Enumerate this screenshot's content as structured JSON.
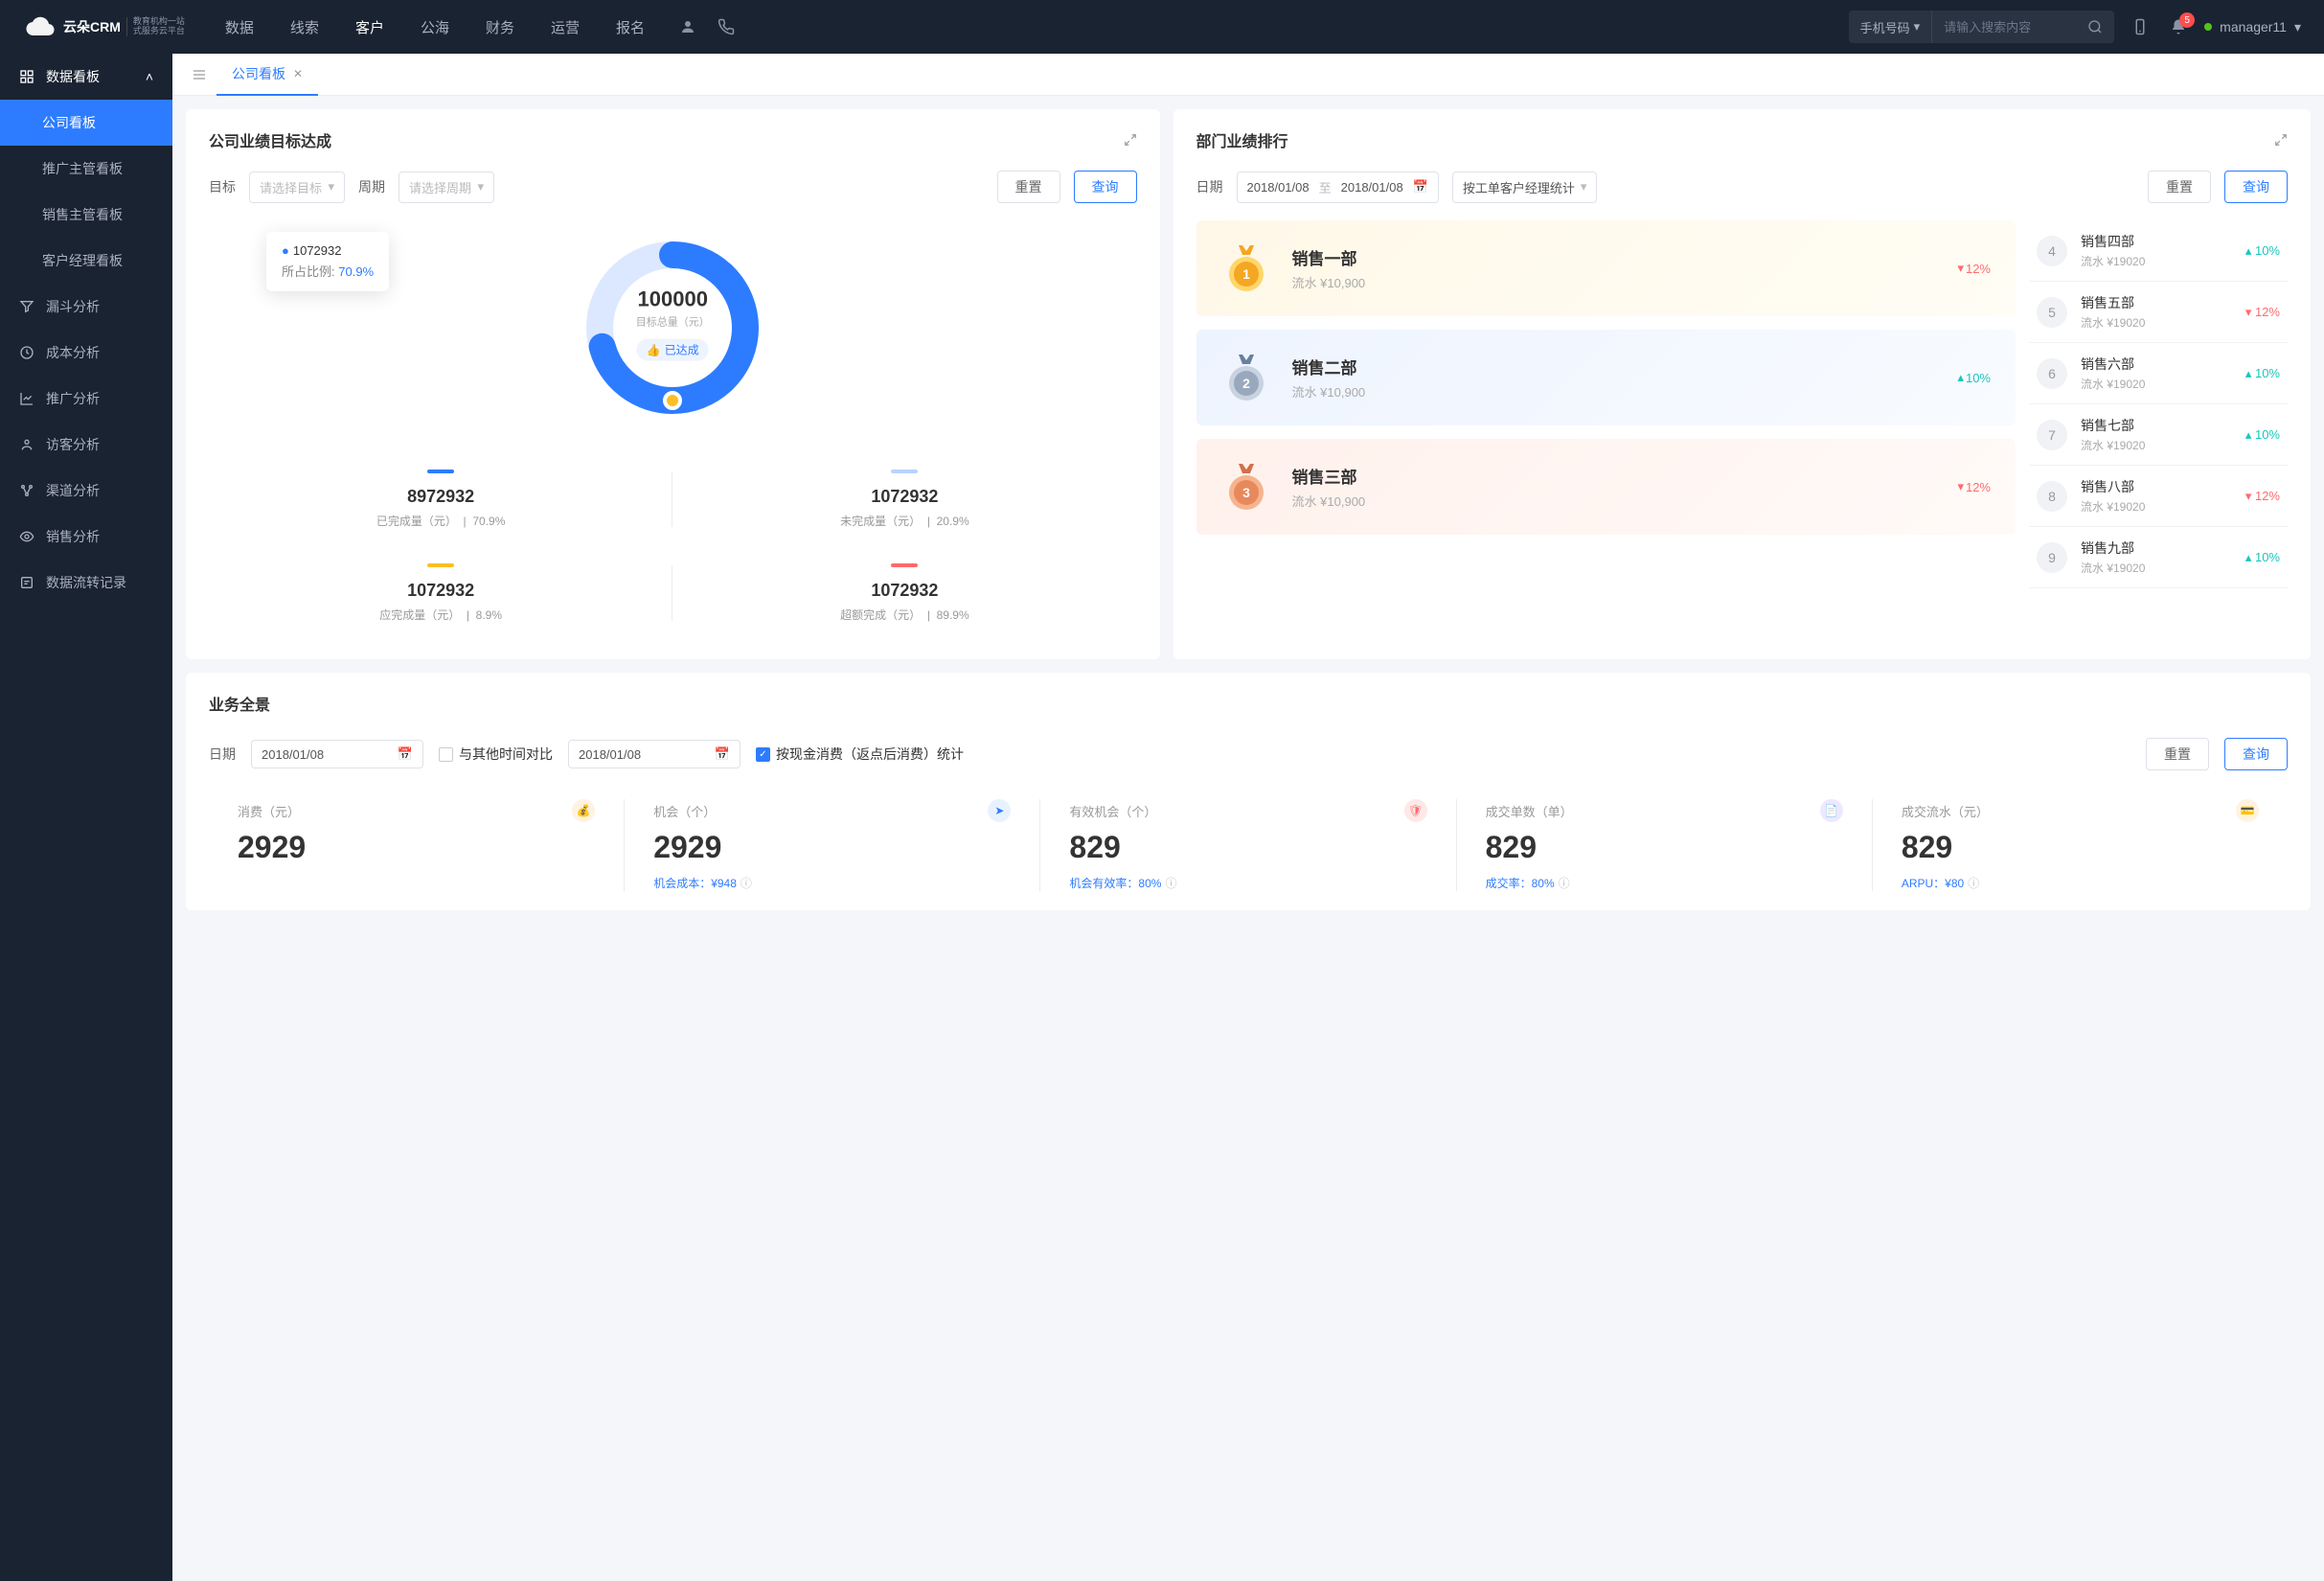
{
  "brand": {
    "name": "云朵CRM",
    "tagline_l1": "教育机构一站",
    "tagline_l2": "式服务云平台"
  },
  "topnav": {
    "items": [
      "数据",
      "线索",
      "客户",
      "公海",
      "财务",
      "运营",
      "报名"
    ],
    "active_index": 2,
    "search_type": "手机号码",
    "search_placeholder": "请输入搜索内容",
    "notification_count": "5",
    "username": "manager11"
  },
  "sidebar": {
    "group_header": "数据看板",
    "group_items": [
      "公司看板",
      "推广主管看板",
      "销售主管看板",
      "客户经理看板"
    ],
    "active_index": 0,
    "singles": [
      {
        "icon": "funnel",
        "label": "漏斗分析"
      },
      {
        "icon": "clock",
        "label": "成本分析"
      },
      {
        "icon": "chart",
        "label": "推广分析"
      },
      {
        "icon": "visitor",
        "label": "访客分析"
      },
      {
        "icon": "channel",
        "label": "渠道分析"
      },
      {
        "icon": "eye",
        "label": "销售分析"
      },
      {
        "icon": "flow",
        "label": "数据流转记录"
      }
    ]
  },
  "tabs": {
    "current": "公司看板"
  },
  "target_card": {
    "title": "公司业绩目标达成",
    "filters": {
      "goal_label": "目标",
      "goal_placeholder": "请选择目标",
      "period_label": "周期",
      "period_placeholder": "请选择周期",
      "reset": "重置",
      "query": "查询"
    },
    "tooltip": {
      "value": "1072932",
      "ratio_label": "所占比例:",
      "ratio_value": "70.9%"
    },
    "center": {
      "value": "100000",
      "label": "目标总量（元）",
      "badge": "已达成"
    },
    "stats": [
      {
        "color": "#2d7cff",
        "value": "8972932",
        "label": "已完成量（元）",
        "pct": "70.9%"
      },
      {
        "color": "#b8d4ff",
        "value": "1072932",
        "label": "未完成量（元）",
        "pct": "20.9%"
      },
      {
        "color": "#fbbf24",
        "value": "1072932",
        "label": "应完成量（元）",
        "pct": "8.9%"
      },
      {
        "color": "#ff6b6b",
        "value": "1072932",
        "label": "超额完成（元）",
        "pct": "89.9%"
      }
    ]
  },
  "rank_card": {
    "title": "部门业绩排行",
    "filters": {
      "date_label": "日期",
      "date_from": "2018/01/08",
      "date_sep": "至",
      "date_to": "2018/01/08",
      "stat_by": "按工单客户经理统计",
      "reset": "重置",
      "query": "查询"
    },
    "podium": [
      {
        "rank": 1,
        "name": "销售一部",
        "sub": "流水 ¥10,900",
        "pct": "12%",
        "dir": "down"
      },
      {
        "rank": 2,
        "name": "销售二部",
        "sub": "流水 ¥10,900",
        "pct": "10%",
        "dir": "up"
      },
      {
        "rank": 3,
        "name": "销售三部",
        "sub": "流水 ¥10,900",
        "pct": "12%",
        "dir": "down"
      }
    ],
    "list": [
      {
        "rank": "4",
        "name": "销售四部",
        "sub": "流水 ¥19020",
        "pct": "10%",
        "dir": "up"
      },
      {
        "rank": "5",
        "name": "销售五部",
        "sub": "流水 ¥19020",
        "pct": "12%",
        "dir": "down"
      },
      {
        "rank": "6",
        "name": "销售六部",
        "sub": "流水 ¥19020",
        "pct": "10%",
        "dir": "up"
      },
      {
        "rank": "7",
        "name": "销售七部",
        "sub": "流水 ¥19020",
        "pct": "10%",
        "dir": "up"
      },
      {
        "rank": "8",
        "name": "销售八部",
        "sub": "流水 ¥19020",
        "pct": "12%",
        "dir": "down"
      },
      {
        "rank": "9",
        "name": "销售九部",
        "sub": "流水 ¥19020",
        "pct": "10%",
        "dir": "up"
      }
    ]
  },
  "overview_card": {
    "title": "业务全景",
    "filters": {
      "date_label": "日期",
      "date1": "2018/01/08",
      "compare_cb": "与其他时间对比",
      "date2": "2018/01/08",
      "stat_cb": "按现金消费（返点后消费）统计",
      "reset": "重置",
      "query": "查询"
    },
    "metrics": [
      {
        "label": "消费（元）",
        "value": "2929",
        "sub_label": "",
        "sub_value": "",
        "icon_bg": "#fff3e0",
        "icon_color": "#f59e0b",
        "icon": "bag"
      },
      {
        "label": "机会（个）",
        "value": "2929",
        "sub_label": "机会成本：",
        "sub_value": "¥948",
        "icon_bg": "#e8f2ff",
        "icon_color": "#2d7cff",
        "icon": "send"
      },
      {
        "label": "有效机会（个）",
        "value": "829",
        "sub_label": "机会有效率：",
        "sub_value": "80%",
        "icon_bg": "#ffe8e8",
        "icon_color": "#ff6b6b",
        "icon": "shield"
      },
      {
        "label": "成交单数（单）",
        "value": "829",
        "sub_label": "成交率：",
        "sub_value": "80%",
        "icon_bg": "#eee8ff",
        "icon_color": "#6965ff",
        "icon": "doc"
      },
      {
        "label": "成交流水（元）",
        "value": "829",
        "sub_label": "ARPU：",
        "sub_value": "¥80",
        "icon_bg": "#fff3e0",
        "icon_color": "#f59e0b",
        "icon": "card"
      }
    ]
  },
  "chart_data": {
    "type": "pie",
    "title": "公司业绩目标达成",
    "total": 100000,
    "total_label": "目标总量（元）",
    "tooltip_value": 1072932,
    "tooltip_ratio": 70.9,
    "series": [
      {
        "name": "已完成量（元）",
        "value": 8972932,
        "pct": 70.9,
        "color": "#2d7cff"
      },
      {
        "name": "未完成量（元）",
        "value": 1072932,
        "pct": 20.9,
        "color": "#b8d4ff"
      },
      {
        "name": "应完成量（元）",
        "value": 1072932,
        "pct": 8.9,
        "color": "#fbbf24"
      },
      {
        "name": "超额完成（元）",
        "value": 1072932,
        "pct": 89.9,
        "color": "#ff6b6b"
      }
    ]
  }
}
